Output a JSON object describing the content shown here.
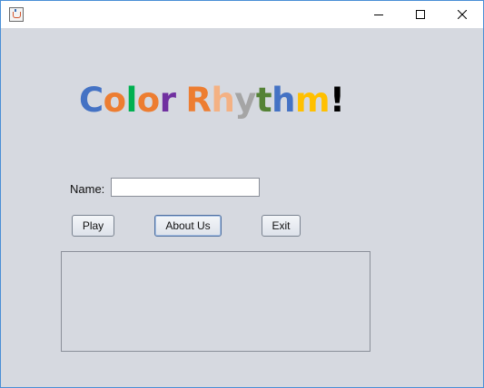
{
  "window": {
    "title": "",
    "controls": {
      "minimize_icon": "minimize-icon",
      "maximize_icon": "maximize-icon",
      "close_icon": "close-icon"
    }
  },
  "app_title": {
    "letters": [
      {
        "char": "C",
        "color": "#4472c4"
      },
      {
        "char": "o",
        "color": "#ed7d31"
      },
      {
        "char": "l",
        "color": "#00b050"
      },
      {
        "char": "o",
        "color": "#ed7d31"
      },
      {
        "char": "r",
        "color": "#7030a0"
      },
      {
        "char": " ",
        "color": "#000000"
      },
      {
        "char": "R",
        "color": "#ed7d31"
      },
      {
        "char": "h",
        "color": "#f4b183"
      },
      {
        "char": "y",
        "color": "#a5a5a5"
      },
      {
        "char": "t",
        "color": "#548235"
      },
      {
        "char": "h",
        "color": "#4472c4"
      },
      {
        "char": "m",
        "color": "#ffc000"
      },
      {
        "char": "!",
        "color": "#000000"
      }
    ]
  },
  "form": {
    "name_label": "Name:",
    "name_value": "",
    "name_placeholder": ""
  },
  "buttons": {
    "play": "Play",
    "about": "About Us",
    "exit": "Exit"
  },
  "output": {
    "text": ""
  }
}
